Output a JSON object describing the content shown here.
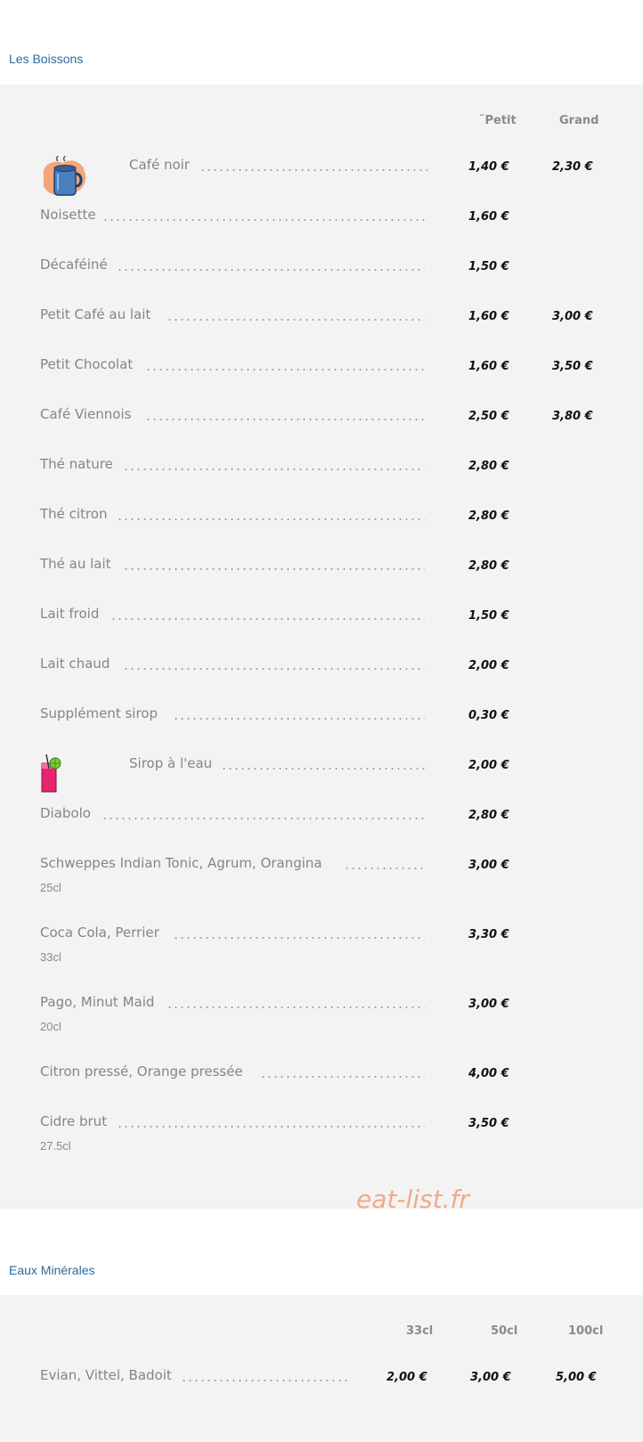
{
  "sections": {
    "boissons": {
      "title": "Les Boissons",
      "col_petit": "¨Petit",
      "col_grand": "Grand",
      "items": [
        {
          "name": "Café noir",
          "petit": "1,40 €",
          "grand": "2,30 €"
        },
        {
          "name": "Noisette",
          "petit": "1,60 €"
        },
        {
          "name": "Décaféiné",
          "petit": "1,50 €"
        },
        {
          "name": "Petit Café au lait",
          "petit": "1,60 €",
          "grand": "3,00 €"
        },
        {
          "name": "Petit Chocolat",
          "petit": "1,60 €",
          "grand": "3,50 €"
        },
        {
          "name": "Café Viennois",
          "petit": "2,50 €",
          "grand": "3,80 €"
        },
        {
          "name": "Thé nature",
          "petit": "2,80 €"
        },
        {
          "name": "Thé citron",
          "petit": "2,80 €"
        },
        {
          "name": "Thé au lait",
          "petit": "2,80 €"
        },
        {
          "name": "Lait froid",
          "petit": "1,50 €"
        },
        {
          "name": "Lait chaud",
          "petit": "2,00 €"
        },
        {
          "name": "Supplément sirop",
          "petit": "0,30 €"
        },
        {
          "name": "Sirop à l'eau",
          "petit": "2,00 €"
        },
        {
          "name": "Diabolo",
          "petit": "2,80 €"
        },
        {
          "name": "Schweppes Indian Tonic, Agrum, Orangina",
          "petit": "3,00 €",
          "note": "25cl"
        },
        {
          "name": "Coca Cola, Perrier",
          "petit": "3,30 €",
          "note": "33cl"
        },
        {
          "name": "Pago, Minut Maid",
          "petit": "3,00 €",
          "note": "20cl"
        },
        {
          "name": "Citron pressé, Orange pressée",
          "petit": "4,00 €"
        },
        {
          "name": "Cidre brut",
          "petit": "3,50 €",
          "note": "27.5cl"
        }
      ]
    },
    "eaux": {
      "title": "Eaux Minérales",
      "col_33": "33cl",
      "col_50": "50cl",
      "col_100": "100cl",
      "items": [
        {
          "name": "Evian, Vittel, Badoit",
          "p33": "2,00 €",
          "p50": "3,00 €",
          "p100": "5,00 €"
        }
      ]
    }
  },
  "watermark": "eat-list.fr",
  "icons": {
    "coffee": "coffee-mug-icon",
    "drink": "cocktail-glass-icon"
  },
  "colors": {
    "section_title": "#2a6a9c",
    "panel_bg": "#f3f3f3",
    "watermark": "#f2a98a"
  }
}
